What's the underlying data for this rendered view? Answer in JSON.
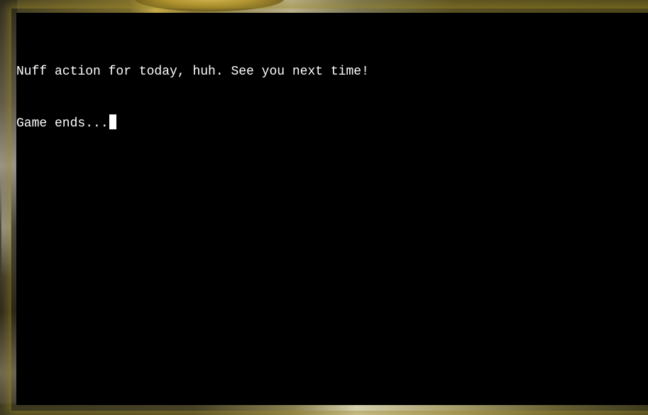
{
  "terminal": {
    "lines": [
      "Nuff action for today, huh. See you next time!",
      "Game ends..."
    ],
    "cursor_visible": true,
    "text_color": "#ffffff",
    "background_color": "#000000"
  },
  "background": {
    "accent_color": "#c5aa48"
  }
}
